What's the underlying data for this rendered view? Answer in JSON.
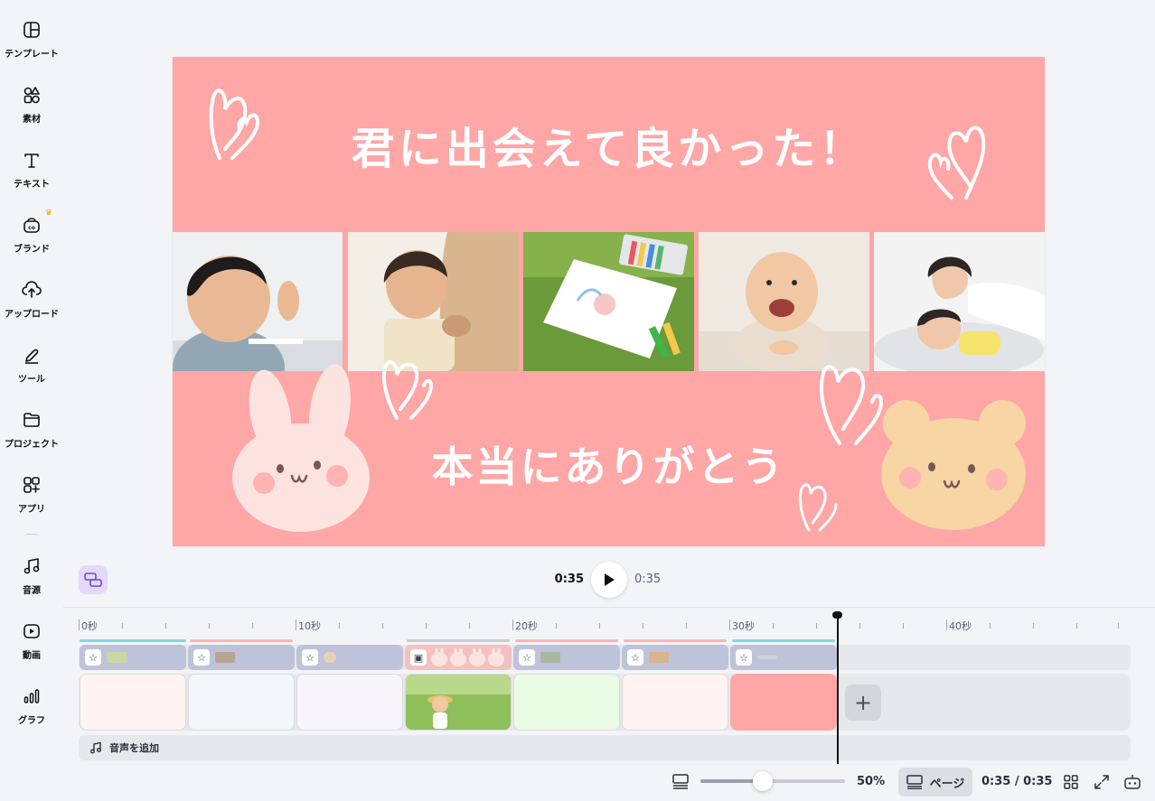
{
  "sidebar": {
    "items": [
      {
        "label": "テンプレート",
        "icon": "template-icon"
      },
      {
        "label": "素材",
        "icon": "elements-icon"
      },
      {
        "label": "テキスト",
        "icon": "text-icon"
      },
      {
        "label": "ブランド",
        "icon": "brand-icon"
      },
      {
        "label": "アップロード",
        "icon": "upload-icon"
      },
      {
        "label": "ツール",
        "icon": "draw-tool-icon"
      },
      {
        "label": "プロジェクト",
        "icon": "folder-icon"
      },
      {
        "label": "アプリ",
        "icon": "apps-icon"
      },
      {
        "label": "音源",
        "icon": "music-icon"
      },
      {
        "label": "動画",
        "icon": "video-icon"
      },
      {
        "label": "グラフ",
        "icon": "chart-icon"
      }
    ]
  },
  "canvas": {
    "title_top": "君に出会えて良かった！",
    "title_bottom": "本当にありがとう",
    "background": "#ffa6a6",
    "photos": [
      "boy-studying-photo",
      "child-with-parent-photo",
      "crayon-drawing-photo",
      "smiling-baby-photo",
      "mother-and-child-photo"
    ]
  },
  "playback": {
    "current_time": "0:35",
    "total_time": "0:35"
  },
  "timeline": {
    "ruler_labels": [
      "0秒",
      "10秒",
      "20秒",
      "30秒",
      "40秒"
    ],
    "add_audio_label": "音声を追加",
    "page_colors": [
      "#fff4f1",
      "#f5f6fc",
      "#f9f5fc",
      "#8fbf5a",
      "#eafde4",
      "#fff4f1",
      "#ffa6a6"
    ]
  },
  "footer": {
    "zoom_percent": "50%",
    "zoom_value": 0.43,
    "page_view_label": "ページ",
    "time_display": "0:35 / 0:35"
  },
  "colors": {
    "accent_purple": "#e4d9fb",
    "chip": "#bfc3d9",
    "teal": "#7fd8e0"
  }
}
